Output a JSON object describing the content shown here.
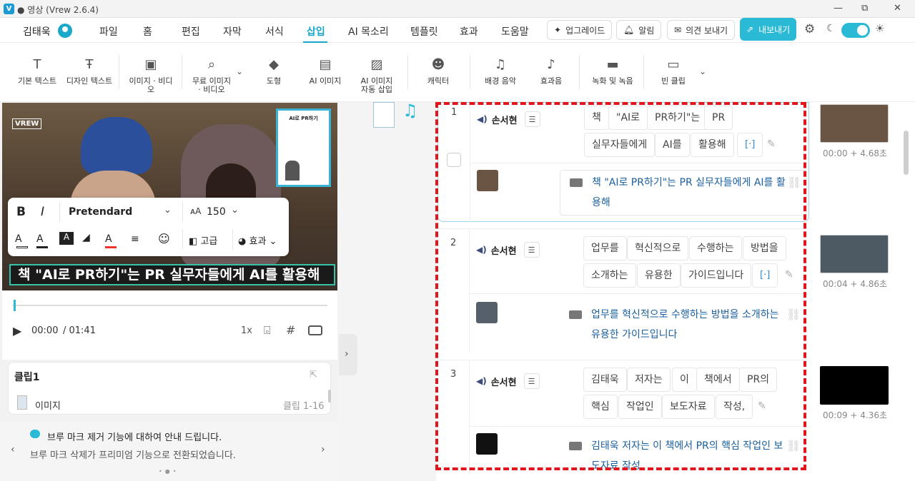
{
  "window": {
    "title": "● 영상 (Vrew 2.6.4)",
    "logo": "V",
    "min": "—",
    "max": "⧉",
    "close": "✕"
  },
  "user": {
    "name": "김태욱"
  },
  "menu": [
    "파일",
    "홈",
    "편집",
    "자막",
    "서식",
    "삽입",
    "AI 목소리",
    "템플릿",
    "효과",
    "도움말"
  ],
  "top_buttons": {
    "upgrade": "업그레이드",
    "alerts": "알림",
    "feedback": "의견 보내기",
    "export": "내보내기"
  },
  "toolbar": [
    "기본 텍스트",
    "디자인 텍스트",
    "이미지 · 비디오",
    "무료 이미지 · 비디오",
    "도형",
    "AI 이미지",
    "AI 이미지 자동 삽입",
    "캐릭터",
    "배경 음악",
    "효과음",
    "녹화 및 녹음",
    "빈 클립"
  ],
  "preview": {
    "overlay_text": "책 \"AI로 PR하기\"는 PR 실무자들에게 AI를 활용해",
    "book_title": "AI로 PR하기",
    "logo_mark": "VREW"
  },
  "format_bar": {
    "font": "Pretendard",
    "size": "150",
    "advanced": "고급",
    "effects": "효과"
  },
  "player": {
    "time": "00:00",
    "duration": "/ 01:41",
    "speed": "1x"
  },
  "clip_card": {
    "title": "클립1",
    "type": "이미지",
    "range": "클립 1-16"
  },
  "notice": {
    "title": "브루 마크 제거 기능에 대하여 안내 드립니다.",
    "body": "브루 마크 삭제가 프리미엄 기능으로 전환되었습니다."
  },
  "clips": [
    {
      "num": "1",
      "speaker": "손서현",
      "words": [
        "책",
        "\"AI로",
        "PR하기\"는",
        "PR",
        "실무자들에게",
        "AI를",
        "활용해",
        "[·]"
      ],
      "subtitle_line1": "책 \"AI로 PR하기\"는 PR 실무자들에게 AI를 활",
      "subtitle_line2": "용해",
      "time": "00:00 + 4.68초"
    },
    {
      "num": "2",
      "speaker": "손서현",
      "words": [
        "업무를",
        "혁신적으로",
        "수행하는",
        "방법을",
        "소개하는",
        "유용한",
        "가이드입니다",
        "[·]"
      ],
      "subtitle_line1": "업무를 혁신적으로 수행하는 방법을 소개하는",
      "subtitle_line2": "유용한 가이드입니다",
      "time": "00:04 + 4.86초"
    },
    {
      "num": "3",
      "speaker": "손서현",
      "words": [
        "김태욱",
        "저자는",
        "이",
        "책에서",
        "PR의",
        "핵심",
        "작업인",
        "보도자료",
        "작성,"
      ],
      "subtitle_line1": "김태욱 저자는 이 책에서 PR의 핵심 작업인 보",
      "subtitle_line2": "도자료 작성,",
      "time": "00:09 + 4.36초"
    }
  ]
}
